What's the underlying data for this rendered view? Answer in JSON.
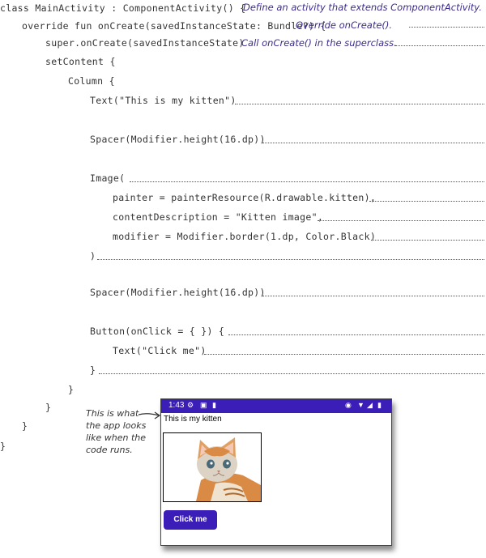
{
  "code": {
    "lines": [
      "class MainActivity : ComponentActivity() {",
      "override fun onCreate(savedInstanceState: Bundle?) {",
      "super.onCreate(savedInstanceState)",
      "setContent {",
      "Column {",
      "Text(\"This is my kitten\")",
      "Spacer(Modifier.height(16.dp))",
      "Image(",
      "painter = painterResource(R.drawable.kitten),",
      "contentDescription = \"Kitten image\",",
      "modifier = Modifier.border(1.dp, Color.Black)",
      ")",
      "Spacer(Modifier.height(16.dp))",
      "Button(onClick = { }) {",
      "Text(\"Click me\")",
      "}",
      "}",
      "}",
      "}",
      "}"
    ]
  },
  "annotations": {
    "define_activity": "Define an activity that extends ComponentActivity.",
    "override_oncreate": "Override onCreate().",
    "call_superclass": "Call onCreate() in the superclass.",
    "app_preview": "This is what the app looks like when the code runs."
  },
  "phone": {
    "status_time": "1:43",
    "app_text": "This is my kitten",
    "button_label": "Click me",
    "accent_color": "#3b1db8"
  }
}
